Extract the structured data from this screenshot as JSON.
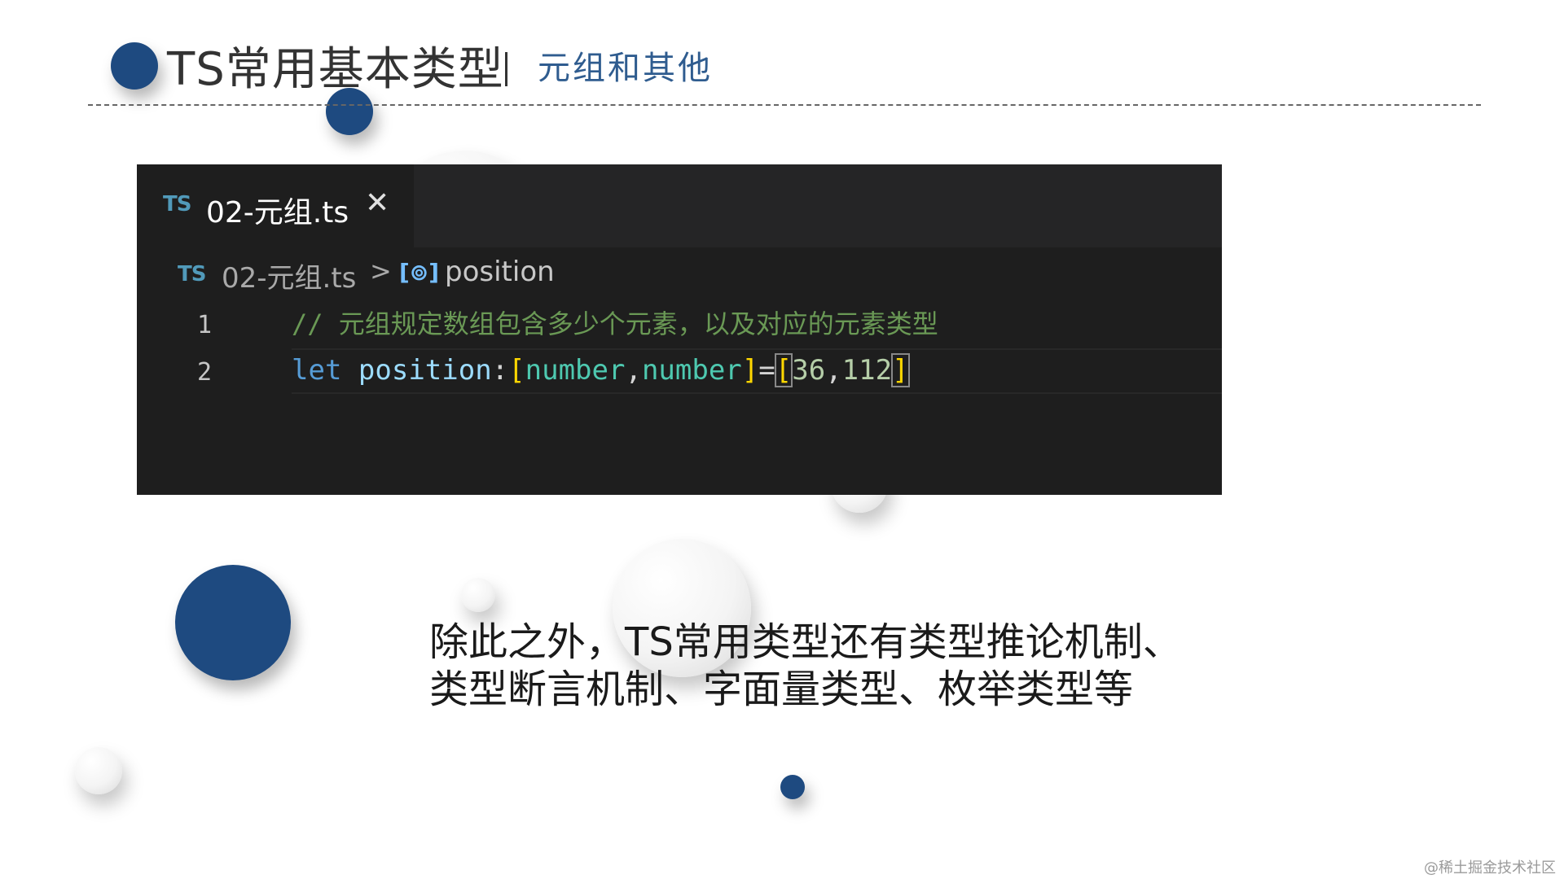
{
  "header": {
    "title": "TS常用基本类型",
    "subtitle": "元组和其他"
  },
  "editor": {
    "tab": {
      "lang_badge": "TS",
      "label": "02-元组.ts",
      "close_glyph": "✕"
    },
    "breadcrumb": {
      "lang_badge": "TS",
      "file": "02-元组.ts",
      "separator": ">",
      "symbol_icon": "[⊚]",
      "symbol": "position"
    },
    "lines": [
      {
        "number": "1",
        "comment": "// 元组规定数组包含多少个元素，以及对应的元素类型"
      },
      {
        "number": "2",
        "keyword": "let",
        "variable": "position",
        "colon": ":",
        "open_bracket": "[",
        "type1": "number",
        "comma1": ",",
        "type2": "number",
        "close_bracket": "]",
        "equals": "=",
        "value_open": "[",
        "value1": "36",
        "comma2": ",",
        "value2": "112",
        "value_close": "]"
      }
    ],
    "icons": [
      "ts-file-icon",
      "close-icon",
      "chevron-right-icon",
      "variable-symbol-icon"
    ]
  },
  "body": {
    "line1": "除此之外，TS常用类型还有类型推论机制、",
    "line2": "类型断言机制、字面量类型、枚举类型等"
  },
  "watermark": "@稀土掘金技术社区",
  "colors": {
    "navy": "#1e4a80",
    "subtitle": "#2f5c8f",
    "editor_bg": "#1e1e1e",
    "keyword": "#569cd6",
    "comment": "#6a9955",
    "type": "#4ec9b0",
    "bracket": "#ffd700"
  }
}
